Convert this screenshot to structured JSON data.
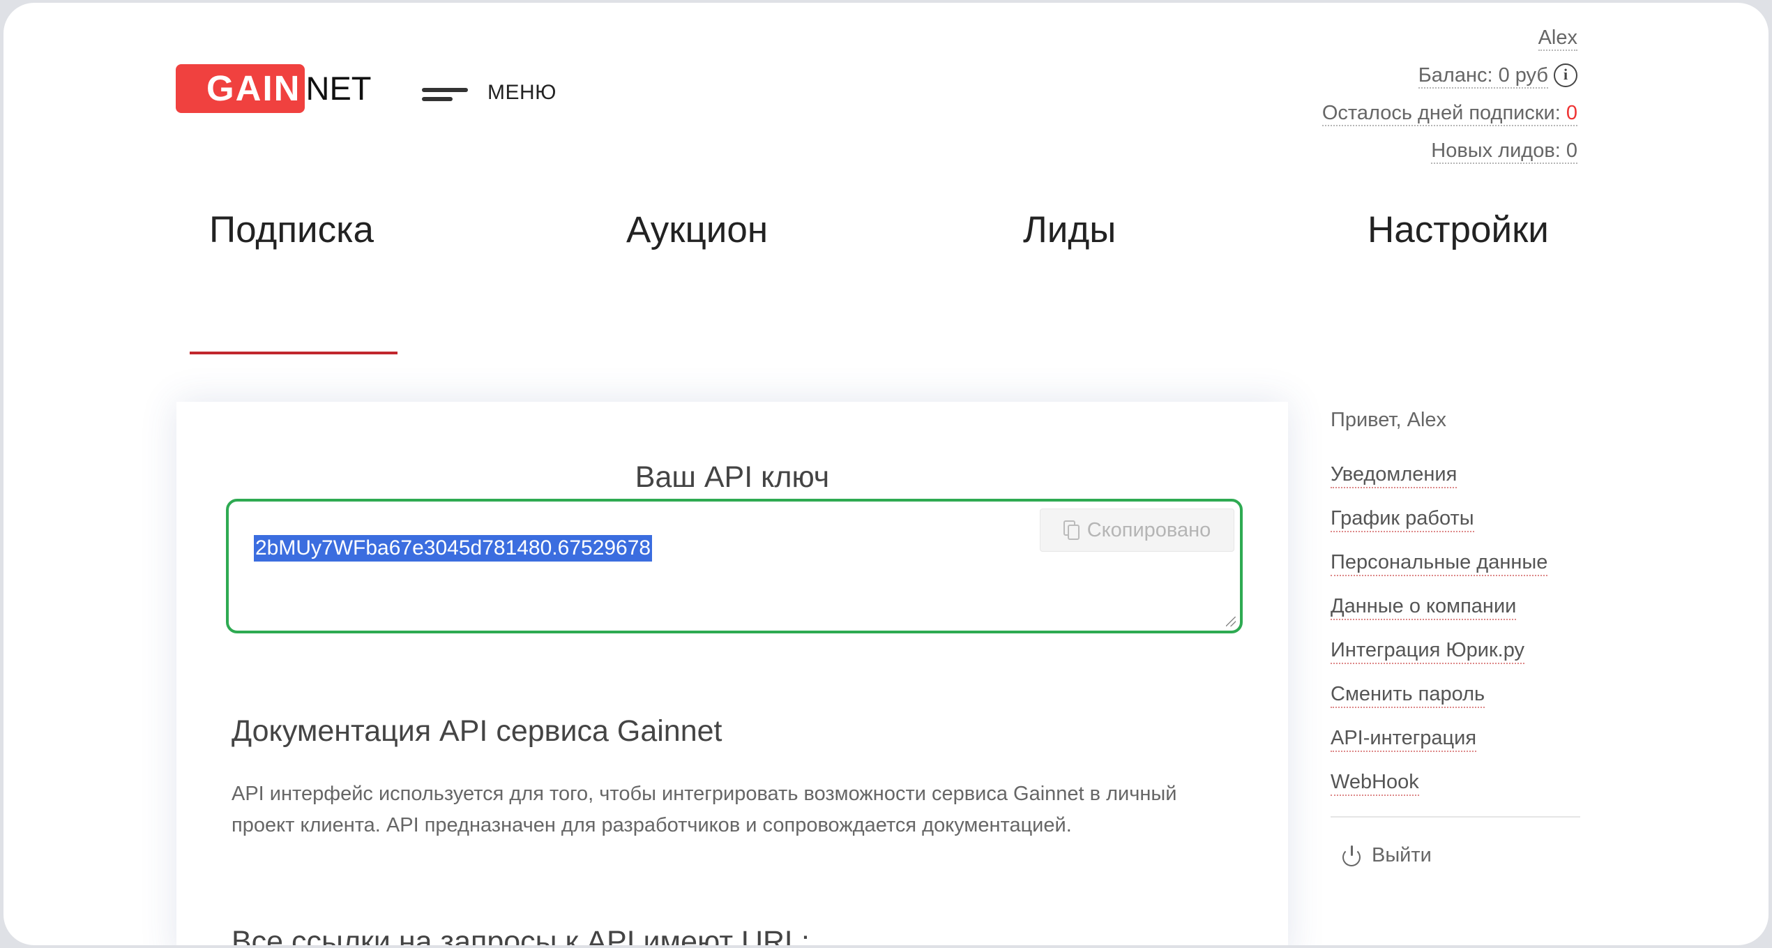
{
  "header": {
    "logo_highlight": "GAIN",
    "logo_rest": "NET",
    "menu_label": "МЕНЮ",
    "user_name": "Alex",
    "balance_label": "Баланс: 0 руб",
    "subscription_days_label": "Осталось дней подписки: ",
    "subscription_days_value": "0",
    "new_leads_label": "Новых лидов: 0"
  },
  "nav": {
    "tabs": [
      {
        "label": "Подписка",
        "active": true
      },
      {
        "label": "Аукцион"
      },
      {
        "label": "Лиды"
      },
      {
        "label": "Настройки"
      }
    ]
  },
  "main": {
    "api_title": "Ваш API ключ",
    "api_key": "2bMUy7WFba67e3045d781480.67529678",
    "copy_button_label": "Скопировано",
    "doc_title": "Документация API сервиса Gainnet",
    "doc_text": "API интерфейс используется для того, чтобы интегрировать возможности сервиса Gainnet в личный проект клиента. API предназначен для разработчиков и сопровождается документацией.",
    "next_heading": "Все ссылки на запросы к API имеют URL:"
  },
  "sidebar": {
    "greeting": "Привет, Alex",
    "items": [
      {
        "label": "Уведомления"
      },
      {
        "label": "График работы"
      },
      {
        "label": "Персональные данные"
      },
      {
        "label": "Данные о компании"
      },
      {
        "label": "Интеграция Юрик.ру"
      },
      {
        "label": "Сменить пароль"
      },
      {
        "label": "API-интеграция"
      },
      {
        "label": "WebHook"
      }
    ],
    "logout_label": "Выйти"
  },
  "colors": {
    "brand_red": "#f0413f",
    "active_underline": "#c1272d",
    "api_box_border": "#2eaa52",
    "selection": "#3b6ddf"
  }
}
